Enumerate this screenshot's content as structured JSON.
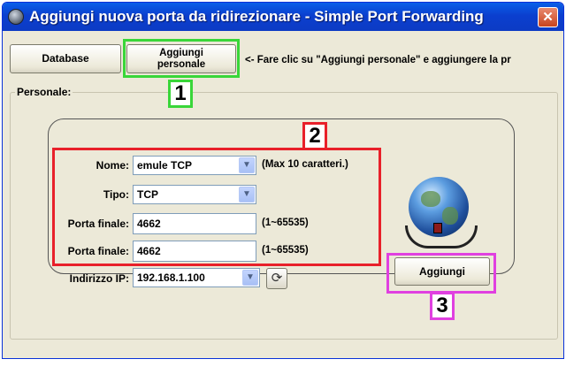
{
  "window": {
    "title": "Aggiungi nuova porta da ridirezionare - Simple Port Forwarding",
    "close_symbol": "✕"
  },
  "toolbar": {
    "database_label": "Database",
    "personal_label_line1": "Aggiungi",
    "personal_label_line2": "personale",
    "hint": "<- Fare clic su \"Aggiungi personale\" e aggiungere la pr"
  },
  "group": {
    "label": "Personale:"
  },
  "form": {
    "name_label": "Nome:",
    "name_value": "emule TCP",
    "name_note": "(Max 10 caratteri.)",
    "type_label": "Tipo:",
    "type_value": "TCP",
    "port1_label": "Porta finale:",
    "port1_value": "4662",
    "port1_note": "(1~65535)",
    "port2_label": "Porta finale:",
    "port2_value": "4662",
    "port2_note": "(1~65535)",
    "ip_label": "Indirizzo IP:",
    "ip_value": "192.168.1.100"
  },
  "add_button": {
    "label": "Aggiungi"
  },
  "annotations": [
    {
      "number": "1",
      "color": "#39d639"
    },
    {
      "number": "2",
      "color": "#e8202a"
    },
    {
      "number": "3",
      "color": "#e040e0"
    }
  ],
  "icons": {
    "app": "app-icon",
    "dropdown_arrow": "▼",
    "refresh": "⟳",
    "globe": "globe-network-icon"
  },
  "colors": {
    "titlebar": "#0b3fcf",
    "window_bg": "#ece9d8"
  }
}
